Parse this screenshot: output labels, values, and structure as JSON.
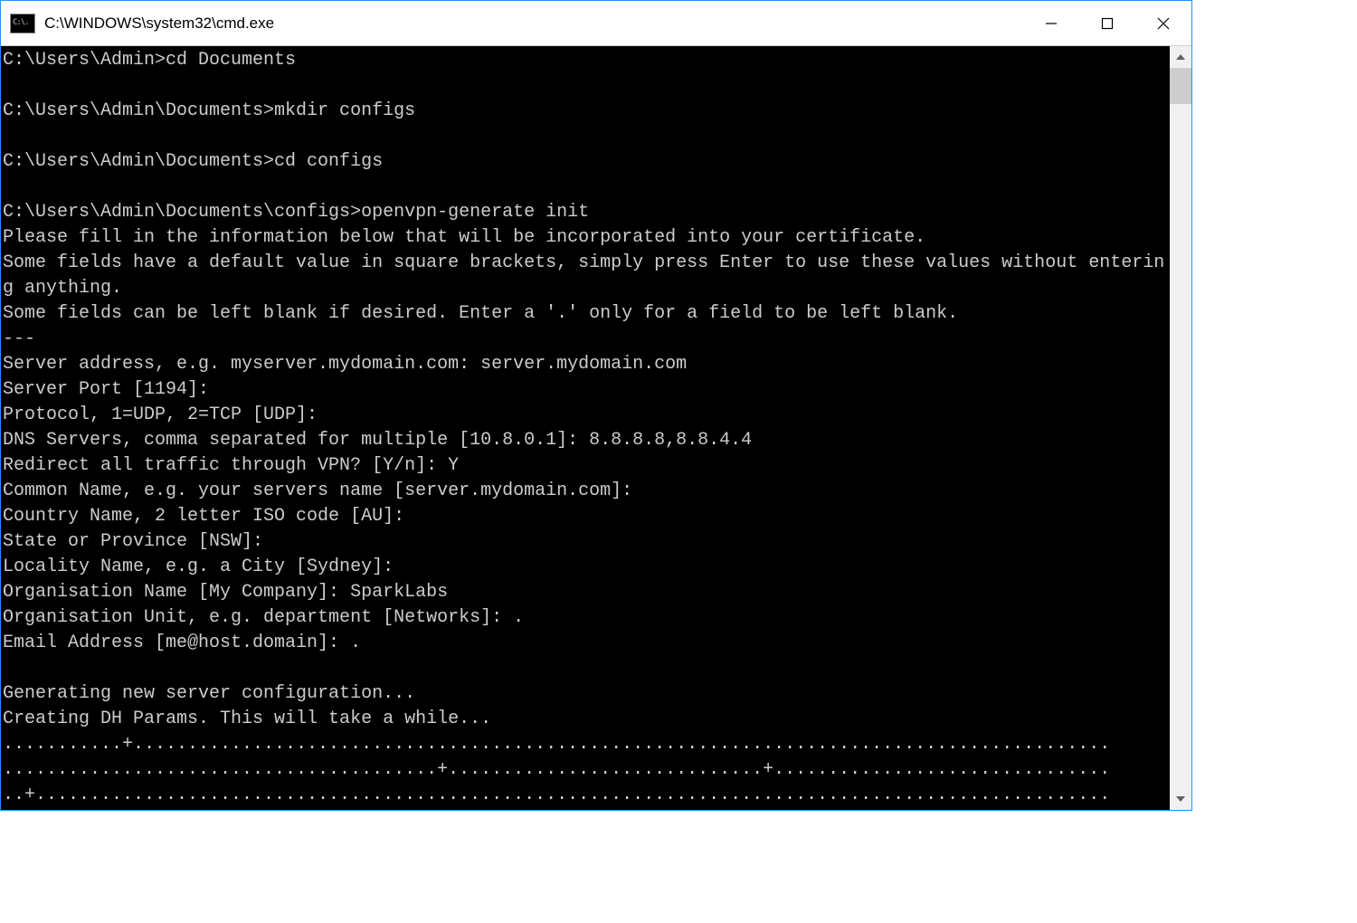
{
  "window": {
    "title": "C:\\WINDOWS\\system32\\cmd.exe"
  },
  "terminal": {
    "lines": [
      "C:\\Users\\Admin>cd Documents",
      "",
      "C:\\Users\\Admin\\Documents>mkdir configs",
      "",
      "C:\\Users\\Admin\\Documents>cd configs",
      "",
      "C:\\Users\\Admin\\Documents\\configs>openvpn-generate init",
      "Please fill in the information below that will be incorporated into your certificate.",
      "Some fields have a default value in square brackets, simply press Enter to use these values without entering anything.",
      "Some fields can be left blank if desired. Enter a '.' only for a field to be left blank.",
      "---",
      "Server address, e.g. myserver.mydomain.com: server.mydomain.com",
      "Server Port [1194]:",
      "Protocol, 1=UDP, 2=TCP [UDP]:",
      "DNS Servers, comma separated for multiple [10.8.0.1]: 8.8.8.8,8.8.4.4",
      "Redirect all traffic through VPN? [Y/n]: Y",
      "Common Name, e.g. your servers name [server.mydomain.com]:",
      "Country Name, 2 letter ISO code [AU]:",
      "State or Province [NSW]:",
      "Locality Name, e.g. a City [Sydney]:",
      "Organisation Name [My Company]: SparkLabs",
      "Organisation Unit, e.g. department [Networks]: .",
      "Email Address [me@host.domain]: .",
      "",
      "Generating new server configuration...",
      "Creating DH Params. This will take a while...",
      "...........+..........................................................................................",
      "........................................+.............................+...............................",
      "..+..................................................................................................."
    ]
  }
}
